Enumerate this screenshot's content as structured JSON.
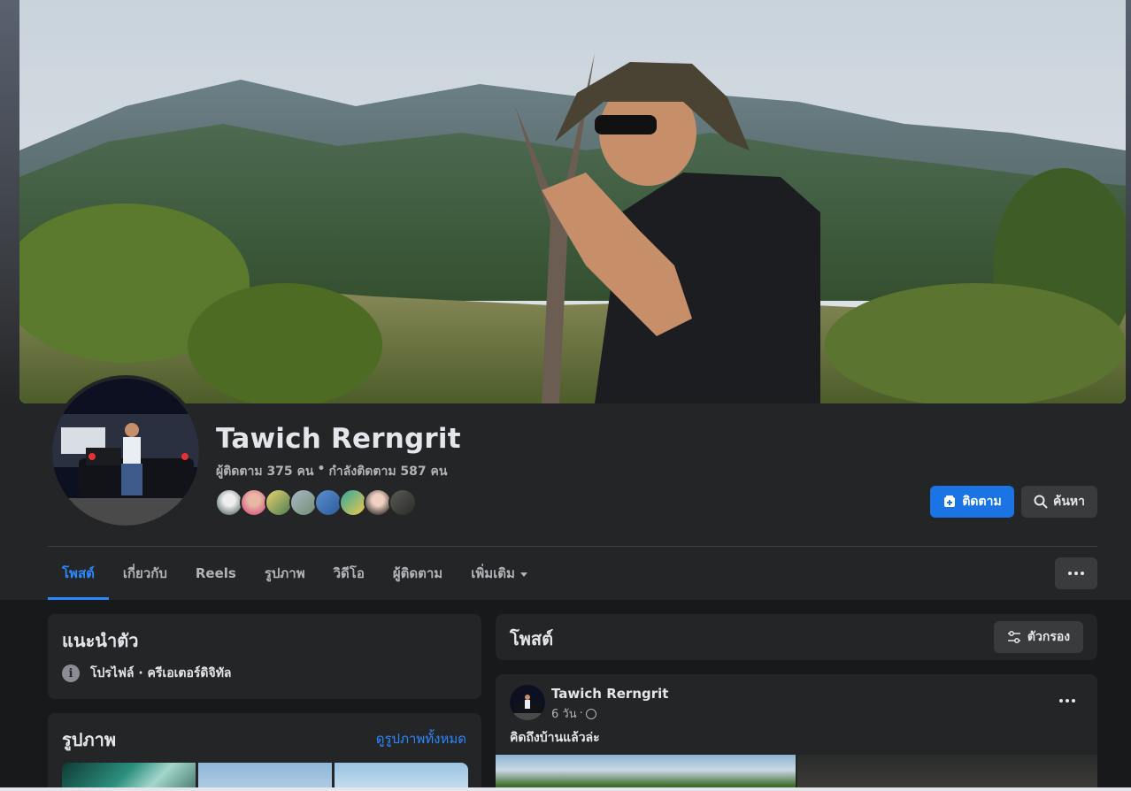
{
  "profile": {
    "name": "Tawich Rerngrit",
    "followers_text": "ผู้ติดตาม 375 คน",
    "separator": "•",
    "following_text": "กำลังติดตาม 587 คน"
  },
  "actions": {
    "follow_label": "ติดตาม",
    "search_label": "ค้นหา"
  },
  "tabs": [
    {
      "label": "โพสต์",
      "active": true
    },
    {
      "label": "เกี่ยวกับ"
    },
    {
      "label": "Reels"
    },
    {
      "label": "รูปภาพ"
    },
    {
      "label": "วิดีโอ"
    },
    {
      "label": "ผู้ติดตาม"
    },
    {
      "label": "เพิ่มเติม"
    }
  ],
  "intro": {
    "title": "แนะนำตัว",
    "detail": "โปรไฟล์ · ครีเอเตอร์ดิจิทัล"
  },
  "photos": {
    "title": "รูปภาพ",
    "see_all": "ดูรูปภาพทั้งหมด"
  },
  "posts": {
    "title": "โพสต์",
    "filter_label": "ตัวกรอง"
  },
  "post": {
    "author": "Tawich Rerngrit",
    "time": "6 วัน",
    "dot": "·",
    "text": "คิดถึงบ้านแล้วล่ะ"
  },
  "colors": {
    "accent": "#2d88ff",
    "button_primary": "#1b74e4",
    "card_bg": "#242526",
    "page_bg": "#18191a"
  }
}
